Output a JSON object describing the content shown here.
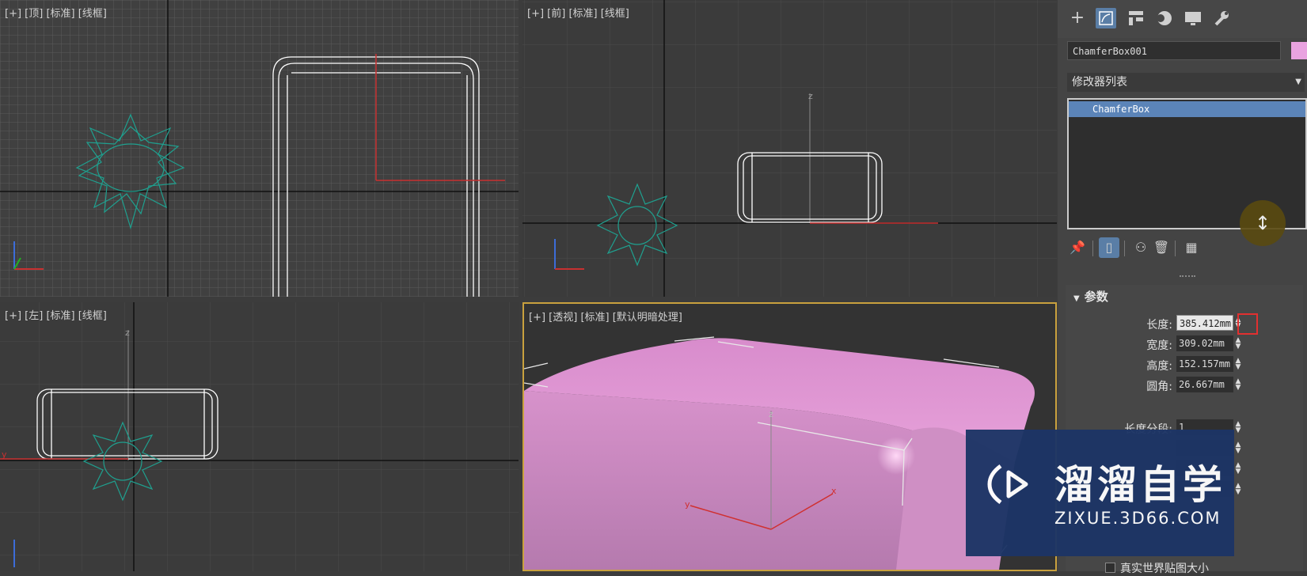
{
  "viewports": {
    "top": {
      "label": "[+] [顶] [标准] [线框]"
    },
    "front": {
      "label": "[+] [前] [标准] [线框]"
    },
    "left": {
      "label": "[+] [左] [标准] [线框]"
    },
    "perspective": {
      "label": "[+] [透视] [标准] [默认明暗处理]"
    }
  },
  "axis_labels": {
    "x": "x",
    "y": "y",
    "z": "z"
  },
  "command_panel": {
    "tabs": [
      "create-icon",
      "modify-icon",
      "hierarchy-icon",
      "motion-icon",
      "display-icon",
      "utilities-icon"
    ],
    "object_name": "ChamferBox001",
    "object_color": "#e9a3e0",
    "modifier_list_label": "修改器列表",
    "modifier_stack": [
      "ChamferBox"
    ],
    "parameters": {
      "title": "参数",
      "length_label": "长度:",
      "length_value": "385.412mm",
      "width_label": "宽度:",
      "width_value": "309.02mm",
      "height_label": "高度:",
      "height_value": "152.157mm",
      "fillet_label": "圆角:",
      "fillet_value": "26.667mm",
      "length_segs_label": "长度分段:",
      "length_segs_value": "1",
      "real_world_label": "真实世界贴图大小"
    }
  },
  "watermark": {
    "title": "溜溜自学",
    "url": "ZIXUE.3D66.COM"
  },
  "colors": {
    "accent": "#5a7ea6",
    "selection": "#5b84b8",
    "active_viewport_border": "#c9a13e",
    "chamferbox_shaded": "#e49ad8",
    "star_wire": "#1fa08f"
  }
}
